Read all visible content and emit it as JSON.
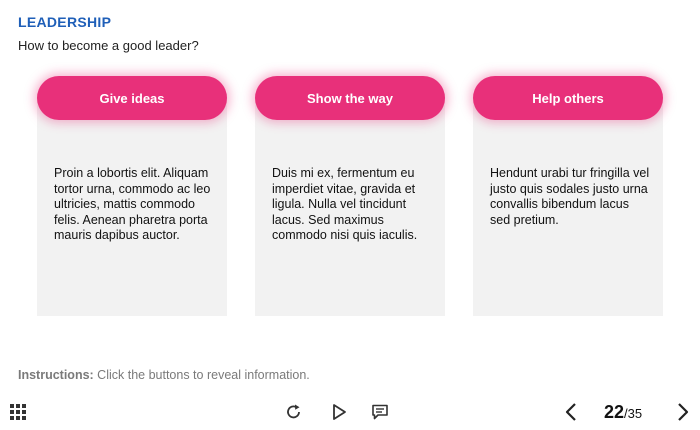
{
  "header": {
    "title": "LEADERSHIP",
    "subtitle": "How to become a good leader?"
  },
  "cards": [
    {
      "label": "Give ideas",
      "text": "Proin a lobortis elit. Aliquam tortor urna, commodo ac leo ultricies, mattis commodo felis. Aenean pharetra porta mauris dapibus auctor."
    },
    {
      "label": "Show the way",
      "text": "Duis mi ex, fermentum eu imperdiet vitae, gravida et ligula. Nulla vel tincidunt lacus. Sed maximus commodo nisi quis iaculis."
    },
    {
      "label": "Help others",
      "text": "Hendunt urabi tur fringilla vel justo quis sodales justo urna convallis bibendum lacus sed pretium."
    }
  ],
  "instructions": {
    "label": "Instructions:",
    "text": " Click the buttons to reveal information."
  },
  "footer": {
    "icons": [
      "grid-menu-icon",
      "replay-icon",
      "play-icon",
      "comment-icon",
      "chevron-left-icon",
      "chevron-right-icon"
    ],
    "page_current": "22",
    "page_total": "/35"
  },
  "colors": {
    "accent": "#e8307a",
    "title": "#1f5fb8",
    "card_bg": "#f2f2f2"
  }
}
